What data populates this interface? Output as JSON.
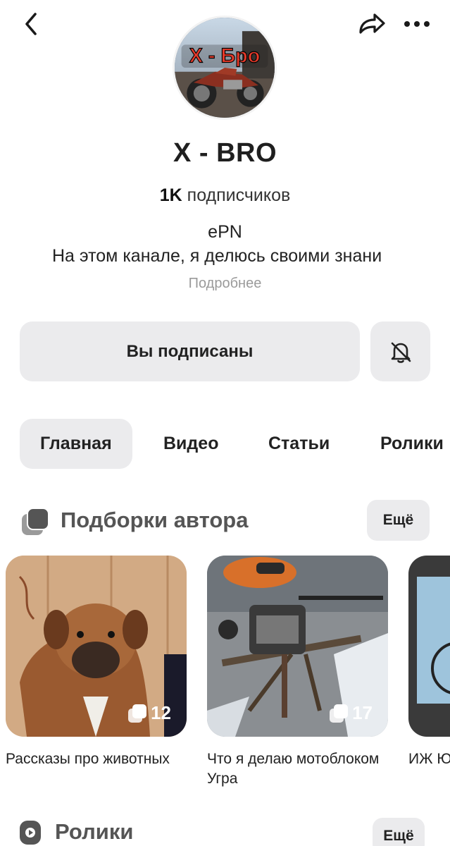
{
  "header": {
    "back_icon": "chevron-left-icon",
    "share_icon": "share-arrow-icon",
    "more_icon": "more-dots-icon"
  },
  "channel": {
    "avatar_text": "X - Бро",
    "title": "X - BRO",
    "subscribers_count": "1K",
    "subscribers_label": "подписчиков",
    "desc_line1": "ePN",
    "desc_line2": "На этом канале, я делюсь своими знани",
    "more_link": "Подробнее"
  },
  "actions": {
    "subscribed_label": "Вы подписаны",
    "bell_icon": "bell-off-icon"
  },
  "tabs": [
    {
      "label": "Главная",
      "active": true
    },
    {
      "label": "Видео",
      "active": false
    },
    {
      "label": "Статьи",
      "active": false
    },
    {
      "label": "Ролики",
      "active": false
    }
  ],
  "collections": {
    "title": "Подборки автора",
    "more_label": "Ещё",
    "items": [
      {
        "title": "Рассказы про животных",
        "count": "12"
      },
      {
        "title": "Что я делаю мотоблоком Угра",
        "count": "17"
      },
      {
        "title": "ИЖ Ю",
        "count": ""
      }
    ]
  },
  "shorts": {
    "title": "Ролики",
    "more_label": "Ещё"
  },
  "colors": {
    "button_bg": "#ebebed",
    "text_primary": "#1f1f1f",
    "text_muted": "#9a9a9a"
  }
}
